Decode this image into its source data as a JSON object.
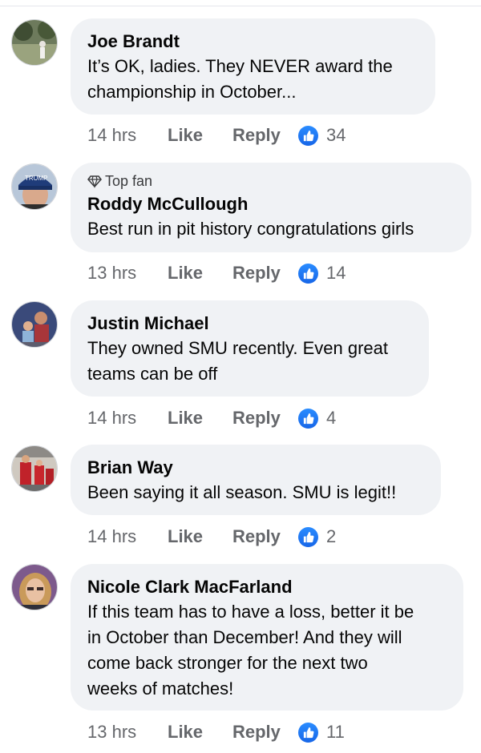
{
  "comments": [
    {
      "name": "Joe Brandt",
      "badge": "",
      "text": "It’s OK, ladies.  They NEVER award the\nchampionship in October...",
      "time": "14 hrs",
      "like_label": "Like",
      "reply_label": "Reply",
      "reactions": "34",
      "avatar_icon": "user-avatar-icon"
    },
    {
      "name": "Roddy McCullough",
      "badge": "Top fan",
      "text": "Best run in pit history congratulations girls",
      "time": "13 hrs",
      "like_label": "Like",
      "reply_label": "Reply",
      "reactions": "14",
      "avatar_icon": "user-avatar-icon"
    },
    {
      "name": "Justin Michael",
      "badge": "",
      "text": "They owned SMU recently. Even great\nteams can be off",
      "time": "14 hrs",
      "like_label": "Like",
      "reply_label": "Reply",
      "reactions": "4",
      "avatar_icon": "user-avatar-icon"
    },
    {
      "name": "Brian Way",
      "badge": "",
      "text": "Been saying it all season. SMU is legit!!",
      "time": "14 hrs",
      "like_label": "Like",
      "reply_label": "Reply",
      "reactions": "2",
      "avatar_icon": "user-avatar-icon"
    },
    {
      "name": "Nicole Clark MacFarland",
      "badge": "",
      "text": "If this team has to have a loss, better it be\nin October than December!  And they will\ncome back stronger for the next two\nweeks of matches!",
      "time": "13 hrs",
      "like_label": "Like",
      "reply_label": "Reply",
      "reactions": "11",
      "avatar_icon": "user-avatar-icon"
    }
  ],
  "colors": {
    "bubble": "#f0f2f5",
    "muted_text": "#65676b",
    "like_reaction": "#1877f2"
  }
}
